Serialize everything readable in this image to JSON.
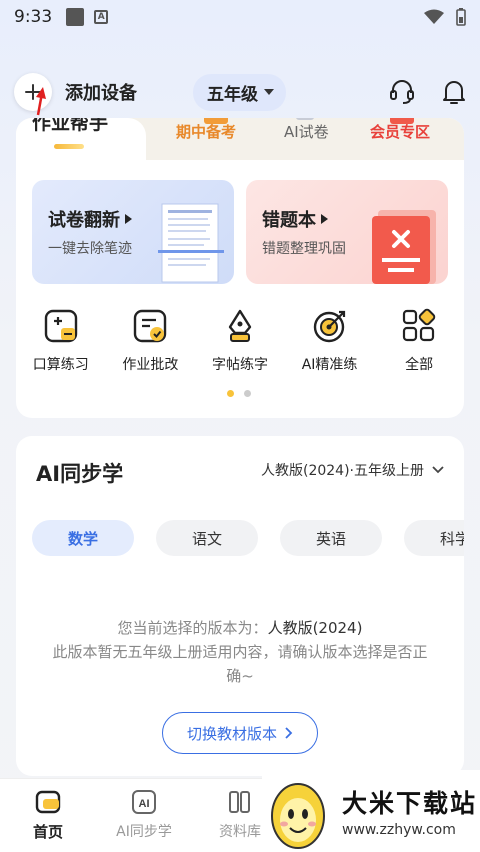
{
  "status_bar": {
    "time": "9:33"
  },
  "header": {
    "add_device": "添加设备",
    "grade": "五年级"
  },
  "tabs": [
    {
      "label": "作业帮手",
      "active": true
    },
    {
      "label": "期中备考"
    },
    {
      "label": "AI试卷"
    },
    {
      "label": "会员专区"
    }
  ],
  "features": [
    {
      "title": "试卷翻新",
      "subtitle": "一键去除笔迹"
    },
    {
      "title": "错题本",
      "subtitle": "错题整理巩固"
    }
  ],
  "tools": [
    {
      "label": "口算练习",
      "icon": "calculator-icon"
    },
    {
      "label": "作业批改",
      "icon": "homework-check-icon"
    },
    {
      "label": "字帖练字",
      "icon": "pen-nib-icon"
    },
    {
      "label": "AI精准练",
      "icon": "target-icon"
    },
    {
      "label": "全部",
      "icon": "grid-icon"
    }
  ],
  "ai_section": {
    "title": "AI同步学",
    "edition": "人教版(2024)·五年级上册",
    "subjects": [
      "数学",
      "语文",
      "英语",
      "科学"
    ],
    "notice_prefix": "您当前选择的版本为：",
    "notice_edition": "人教版(2024)",
    "notice_rest": "此版本暂无五年级上册适用内容，请确认版本选择是否正确~",
    "switch_button": "切换教材版本"
  },
  "bottom_nav": [
    {
      "label": "首页",
      "active": true
    },
    {
      "label": "AI同步学"
    },
    {
      "label": "资料库"
    }
  ],
  "watermark": {
    "name": "大米下载站",
    "url": "www.zzhyw.com"
  },
  "colors": {
    "accent": "#3a6fe3",
    "highlight": "#f8c33a",
    "vip": "#e8413b"
  }
}
